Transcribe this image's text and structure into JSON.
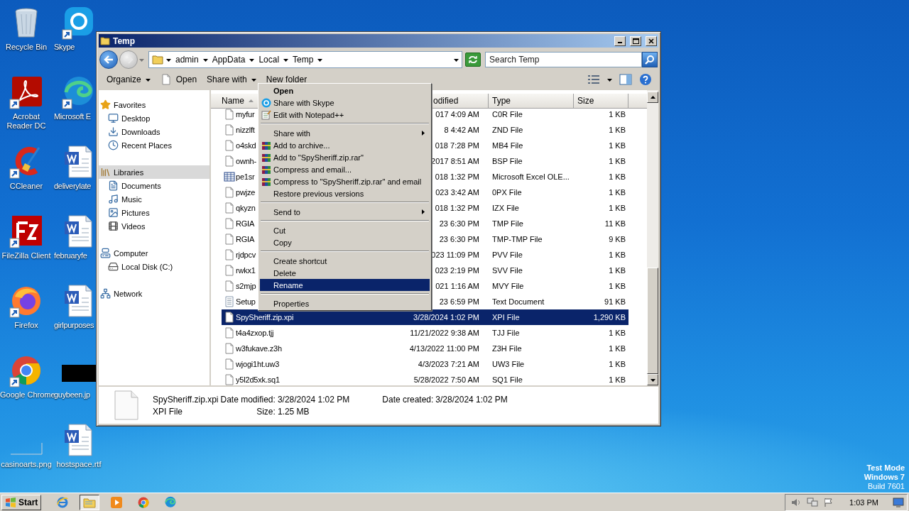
{
  "desktop_icons": [
    {
      "label": "Recycle Bin",
      "kind": "bin",
      "shortcut": false
    },
    {
      "label": "Skype",
      "kind": "chat",
      "shortcut": true
    },
    {
      "label": "Acrobat Reader DC",
      "kind": "reader",
      "shortcut": true
    },
    {
      "label": "Microsoft E",
      "kind": "wave",
      "shortcut": true
    },
    {
      "label": "CCleaner",
      "kind": "cleaner",
      "shortcut": true
    },
    {
      "label": "deliverylate",
      "kind": "document",
      "shortcut": false
    },
    {
      "label": "FileZilla Client",
      "kind": "transfer",
      "shortcut": true
    },
    {
      "label": "februaryfe",
      "kind": "document",
      "shortcut": false
    },
    {
      "label": "Firefox",
      "kind": "fox",
      "shortcut": true
    },
    {
      "label": "girlpurposes",
      "kind": "document",
      "shortcut": false
    },
    {
      "label": "Google Chrome",
      "kind": "sphere",
      "shortcut": true
    },
    {
      "label": "guybeen.jp",
      "kind": "darkimage",
      "shortcut": false
    },
    {
      "label": "casinoarts.png",
      "kind": "blankimage",
      "shortcut": false
    },
    {
      "label": "hostspace.rtf",
      "kind": "document",
      "shortcut": false
    }
  ],
  "window": {
    "title": "Temp",
    "address": [
      "admin",
      "AppData",
      "Local",
      "Temp"
    ],
    "search": {
      "placeholder": "Search Temp"
    },
    "toolbar": [
      {
        "label": "Organize",
        "kind": "dropdown"
      },
      {
        "label": "Open",
        "kind": "file"
      },
      {
        "label": "Share with",
        "kind": "dropdown"
      },
      {
        "label": "New folder",
        "kind": "plain"
      }
    ],
    "nav": [
      {
        "label": "Favorites",
        "kind": "star",
        "selected": false,
        "children": [
          {
            "label": "Desktop",
            "kind": "desktop",
            "selected": false
          },
          {
            "label": "Downloads",
            "kind": "downloads",
            "selected": false
          },
          {
            "label": "Recent Places",
            "kind": "recent",
            "selected": false
          }
        ]
      },
      {
        "label": "Libraries",
        "kind": "library",
        "selected": true,
        "children": [
          {
            "label": "Documents",
            "kind": "documents",
            "selected": false
          },
          {
            "label": "Music",
            "kind": "music",
            "selected": false
          },
          {
            "label": "Pictures",
            "kind": "pictures",
            "selected": false
          },
          {
            "label": "Videos",
            "kind": "videos",
            "selected": false
          }
        ]
      },
      {
        "label": "Computer",
        "kind": "computer",
        "selected": false,
        "children": [
          {
            "label": "Local Disk (C:)",
            "kind": "disk",
            "selected": false
          }
        ]
      },
      {
        "label": "Network",
        "kind": "network",
        "selected": false
      }
    ],
    "columns": [
      {
        "label": "Name",
        "sorted": true
      },
      {
        "label": "odified",
        "sorted": false
      },
      {
        "label": "Type",
        "sorted": false
      },
      {
        "label": "Size",
        "sorted": false
      }
    ],
    "rows": [
      {
        "name": "myfur",
        "date": "017 4:09 AM",
        "type": "C0R File",
        "size": "1 KB",
        "kind": "file",
        "selected": false
      },
      {
        "name": "nizzlft",
        "date": "8 4:42 AM",
        "type": "ZND File",
        "size": "1 KB",
        "kind": "file",
        "selected": false
      },
      {
        "name": "o4skd",
        "date": "018 7:28 PM",
        "type": "MB4 File",
        "size": "1 KB",
        "kind": "file",
        "selected": false
      },
      {
        "name": "ownh-",
        "date": "2017 8:51 AM",
        "type": "BSP File",
        "size": "1 KB",
        "kind": "file",
        "selected": false
      },
      {
        "name": "pe1sr",
        "date": "018 1:32 PM",
        "type": "Microsoft Excel OLE...",
        "size": "1 KB",
        "kind": "spreadsheet",
        "selected": false
      },
      {
        "name": "pwjze",
        "date": "023 3:42 AM",
        "type": "0PX File",
        "size": "1 KB",
        "kind": "file",
        "selected": false
      },
      {
        "name": "qkyzn",
        "date": "018 1:32 PM",
        "type": "IZX File",
        "size": "1 KB",
        "kind": "file",
        "selected": false
      },
      {
        "name": "RGIA",
        "date": "23 6:30 PM",
        "type": "TMP File",
        "size": "11 KB",
        "kind": "file",
        "selected": false
      },
      {
        "name": "RGIA",
        "date": "23 6:30 PM",
        "type": "TMP-TMP File",
        "size": "9 KB",
        "kind": "file",
        "selected": false
      },
      {
        "name": "rjdpcv",
        "date": "023 11:09 PM",
        "type": "PVV File",
        "size": "1 KB",
        "kind": "file",
        "selected": false
      },
      {
        "name": "rwkx1",
        "date": "023 2:19 PM",
        "type": "SVV File",
        "size": "1 KB",
        "kind": "file",
        "selected": false
      },
      {
        "name": "s2mjp",
        "date": "021 1:16 AM",
        "type": "MVY File",
        "size": "1 KB",
        "kind": "file",
        "selected": false
      },
      {
        "name": "Setup",
        "date": "23 6:59 PM",
        "type": "Text Document",
        "size": "91 KB",
        "kind": "text",
        "selected": false
      },
      {
        "name": "SpySheriff.zip.xpi",
        "date": "3/28/2024 1:02 PM",
        "type": "XPI File",
        "size": "1,290 KB",
        "kind": "file",
        "selected": true
      },
      {
        "name": "t4a4zxop.tjj",
        "date": "11/21/2022 9:38 AM",
        "type": "TJJ File",
        "size": "1 KB",
        "kind": "file",
        "selected": false
      },
      {
        "name": "w3fukave.z3h",
        "date": "4/13/2022 11:00 PM",
        "type": "Z3H File",
        "size": "1 KB",
        "kind": "file",
        "selected": false
      },
      {
        "name": "wjogi1ht.uw3",
        "date": "4/3/2023 7:21 AM",
        "type": "UW3 File",
        "size": "1 KB",
        "kind": "file",
        "selected": false
      },
      {
        "name": "y5l2d5xk.sq1",
        "date": "5/28/2022 7:50 AM",
        "type": "SQ1 File",
        "size": "1 KB",
        "kind": "file",
        "selected": false
      }
    ],
    "details": {
      "name": "SpySheriff.zip.xpi",
      "type": "XPI File",
      "fields": [
        {
          "label": "Date modified:",
          "value": "3/28/2024 1:02 PM"
        },
        {
          "label": "Size:",
          "value": "1.25 MB"
        },
        {
          "label": "Date created:",
          "value": "3/28/2024 1:02 PM"
        }
      ]
    }
  },
  "context_menu": [
    [
      {
        "label": "Open",
        "kind": "plain",
        "default": true,
        "submenu": false,
        "selected": false
      },
      {
        "label": "Share with Skype",
        "kind": "chat",
        "default": false,
        "submenu": false,
        "selected": false
      },
      {
        "label": "Edit with Notepad++",
        "kind": "notepad",
        "default": false,
        "submenu": false,
        "selected": false
      }
    ],
    [
      {
        "label": "Share with",
        "kind": "plain",
        "default": false,
        "submenu": true,
        "selected": false
      },
      {
        "label": "Add to archive...",
        "kind": "archive",
        "default": false,
        "submenu": false,
        "selected": false
      },
      {
        "label": "Add to \"SpySheriff.zip.rar\"",
        "kind": "archive",
        "default": false,
        "submenu": false,
        "selected": false
      },
      {
        "label": "Compress and email...",
        "kind": "archive",
        "default": false,
        "submenu": false,
        "selected": false
      },
      {
        "label": "Compress to \"SpySheriff.zip.rar\" and email",
        "kind": "archive",
        "default": false,
        "submenu": false,
        "selected": false
      },
      {
        "label": "Restore previous versions",
        "kind": "plain",
        "default": false,
        "submenu": false,
        "selected": false
      }
    ],
    [
      {
        "label": "Send to",
        "kind": "plain",
        "default": false,
        "submenu": true,
        "selected": false
      }
    ],
    [
      {
        "label": "Cut",
        "kind": "plain",
        "default": false,
        "submenu": false,
        "selected": false
      },
      {
        "label": "Copy",
        "kind": "plain",
        "default": false,
        "submenu": false,
        "selected": false
      }
    ],
    [
      {
        "label": "Create shortcut",
        "kind": "plain",
        "default": false,
        "submenu": false,
        "selected": false
      },
      {
        "label": "Delete",
        "kind": "plain",
        "default": false,
        "submenu": false,
        "selected": false
      },
      {
        "label": "Rename",
        "kind": "plain",
        "default": false,
        "submenu": false,
        "selected": true
      }
    ],
    [
      {
        "label": "Properties",
        "kind": "plain",
        "default": false,
        "submenu": false,
        "selected": false
      }
    ]
  ],
  "system_notice": [
    "Test Mode",
    "Windows 7",
    "Build 7601"
  ],
  "taskbar": {
    "start": "Start",
    "apps": [
      {
        "kind": "ie",
        "selected": false
      },
      {
        "kind": "folder",
        "selected": true
      },
      {
        "kind": "player",
        "selected": false
      },
      {
        "kind": "sphere",
        "selected": false
      },
      {
        "kind": "wave",
        "selected": false
      }
    ],
    "clock": "1:03 PM"
  }
}
